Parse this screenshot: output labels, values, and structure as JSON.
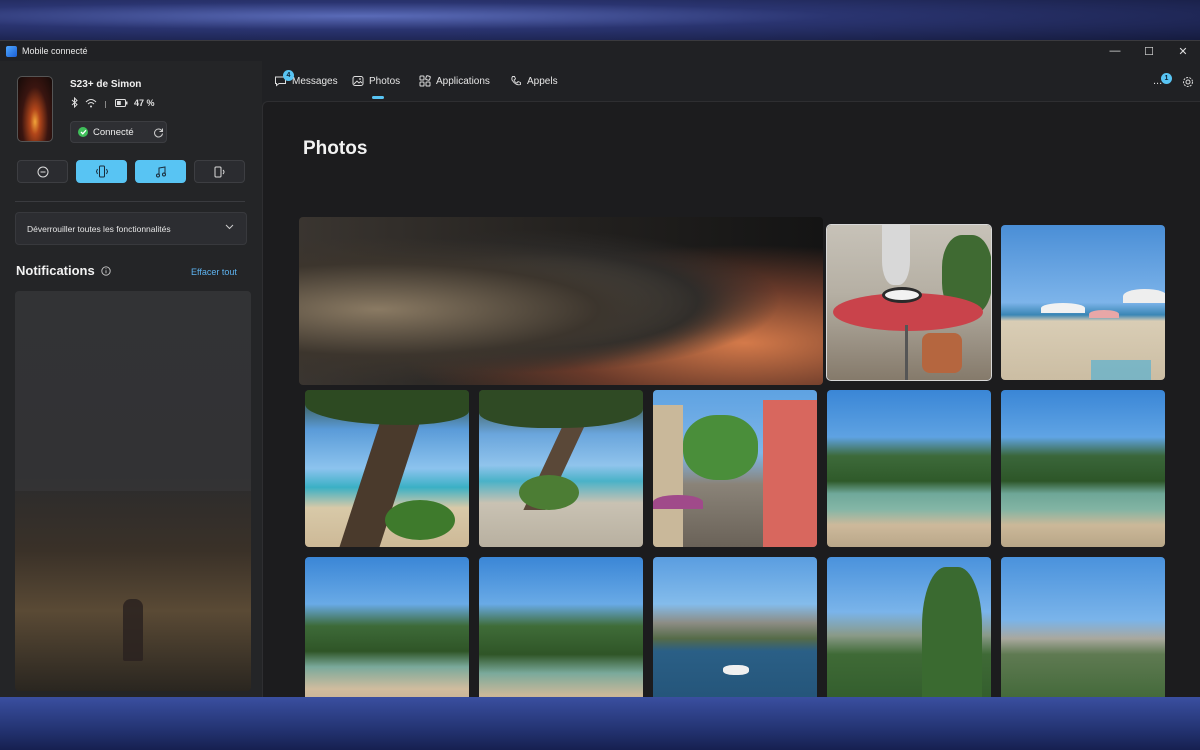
{
  "window": {
    "title": "Mobile connecté",
    "minimize": "—",
    "maximize": "☐",
    "close": "✕"
  },
  "device": {
    "name": "S23+ de Simon",
    "battery": "47 %",
    "connection_label": "Connecté",
    "battery_level": 0.47
  },
  "quick_buttons": [
    {
      "icon": "minus-circle-icon",
      "active": false
    },
    {
      "icon": "phone-vibrate-icon",
      "active": true
    },
    {
      "icon": "music-note-icon",
      "active": true
    },
    {
      "icon": "phone-audio-icon",
      "active": false
    }
  ],
  "unlock": {
    "label": "Déverrouiller toutes les fonctionnalités"
  },
  "notifications": {
    "title": "Notifications",
    "clear_label": "Effacer tout"
  },
  "tabs": [
    {
      "label": "Messages",
      "badge": "4",
      "icon": "message-icon"
    },
    {
      "label": "Photos",
      "icon": "photo-icon",
      "active": true
    },
    {
      "label": "Applications",
      "icon": "apps-icon"
    },
    {
      "label": "Appels",
      "icon": "phone-icon"
    }
  ],
  "header_more": {
    "label": "...",
    "badge": "1"
  },
  "main": {
    "title": "Photos"
  },
  "colors": {
    "accent": "#58c4f3",
    "connected": "#3fbf5a",
    "link": "#5db3f0"
  }
}
